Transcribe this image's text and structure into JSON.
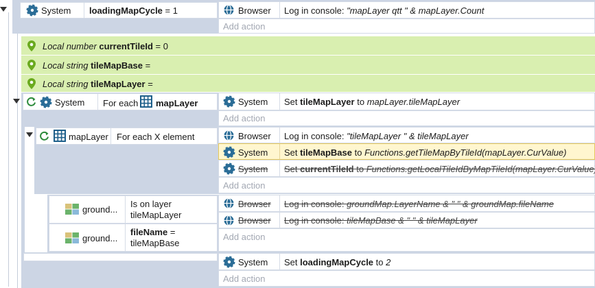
{
  "event1": {
    "condition": {
      "object": "System",
      "text": "loadingMapCycle",
      "suffix": " = 1"
    },
    "actions": [
      {
        "object": "Browser",
        "prefix": "Log in console: ",
        "expr": "\"mapLayer qtt \" & mapLayer.Count"
      }
    ],
    "add_action": "Add action"
  },
  "locals": [
    {
      "kind": "Local number",
      "name": "currentTileId",
      "value": " = 0"
    },
    {
      "kind": "Local string",
      "name": "tileMapBase",
      "value": " ="
    },
    {
      "kind": "Local string",
      "name": "tileMapLayer",
      "value": " ="
    }
  ],
  "event2": {
    "condition": {
      "object": "System",
      "prefix": "For each",
      "name": "mapLayer"
    },
    "actions": [
      {
        "object": "System",
        "prefix": "Set ",
        "name": "tileMapLayer",
        "mid": " to ",
        "expr": "mapLayer.tileMapLayer"
      }
    ],
    "add_action": "Add action"
  },
  "event3": {
    "condition": {
      "object": "mapLayer",
      "text": "For each X element"
    },
    "actions": [
      {
        "object": "Browser",
        "prefix": "Log in console: ",
        "expr": "\"tileMapLayer \" & tileMapLayer"
      },
      {
        "object": "System",
        "prefix": "Set ",
        "name": "tileMapBase",
        "mid": " to ",
        "expr": "Functions.getTileMapByTileId(mapLayer.CurValue)"
      },
      {
        "object": "System",
        "prefix": "Set ",
        "name": "currentTileId",
        "mid": " to ",
        "expr": "Functions.getLocalTileIdByMapTileId(mapLayer.CurValue)"
      }
    ],
    "add_action": "Add action"
  },
  "event4": {
    "conditions": [
      {
        "object": "ground...",
        "line1": "Is on layer",
        "line2": "tileMapLayer"
      },
      {
        "object": "ground...",
        "name": "fileName",
        "suffix": " =",
        "line2": "tileMapBase"
      }
    ],
    "actions": [
      {
        "object": "Browser",
        "prefix": "Log in console: ",
        "expr": "groundMap.LayerName & \" \" & groundMap.fileName"
      },
      {
        "object": "Browser",
        "prefix": "Log in console: ",
        "expr": "tileMapBase & \" \" & tileMapLayer"
      }
    ],
    "add_action": "Add action"
  },
  "event5": {
    "actions": [
      {
        "object": "System",
        "prefix": "Set ",
        "name": "loadingMapCycle",
        "mid": " to ",
        "expr": "2"
      }
    ],
    "add_action": "Add action"
  },
  "colors": {
    "band": "#ccd5e4",
    "local_bg": "#d9efb0",
    "highlight": "#fff6cf",
    "gear": "#2b6d97",
    "pin": "#6aaa1e",
    "grid": "#1d5f8a"
  }
}
